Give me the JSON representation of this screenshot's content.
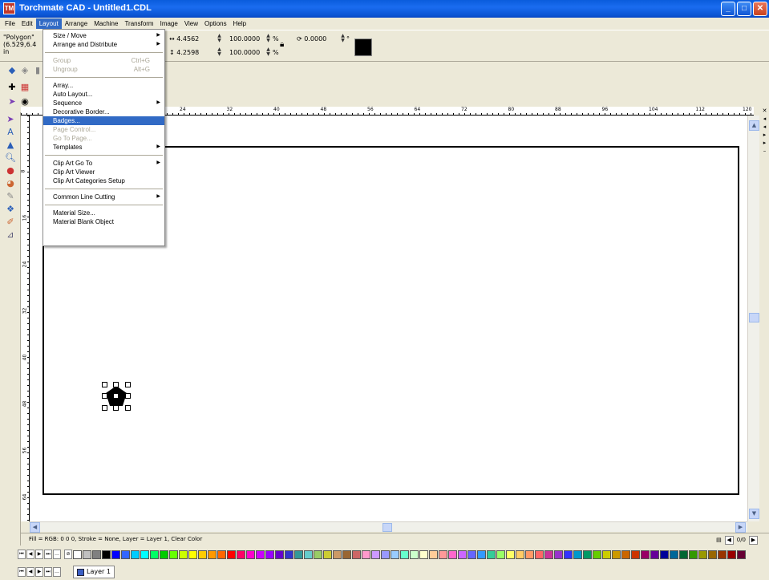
{
  "window": {
    "title": "Torchmate CAD - Untitled1.CDL",
    "app_icon_label": "TM",
    "minimize": "_",
    "maximize": "□",
    "close": "✕"
  },
  "menubar": {
    "items": [
      "File",
      "Edit",
      "Layout",
      "Arrange",
      "Machine",
      "Transform",
      "Image",
      "View",
      "Options",
      "Help"
    ],
    "active": "Layout"
  },
  "properties": {
    "object_name": "\"Polygon\"",
    "object_pos": "(6.529,6.4",
    "unit": "in",
    "width_label": "↔",
    "width": "4.4562",
    "height_label": "↕",
    "height": "4.2598",
    "scale_x": "100.0000",
    "scale_y": "100.0000",
    "percent": "%",
    "rotate_label": "⟳",
    "rotation": "0.0000",
    "degree": "°"
  },
  "layout_menu": {
    "items": [
      {
        "label": "Size / Move",
        "submenu": true
      },
      {
        "label": "Arrange and Distribute",
        "submenu": true
      },
      {
        "sep": true
      },
      {
        "label": "Group",
        "shortcut": "Ctrl+G",
        "disabled": true
      },
      {
        "label": "Ungroup",
        "shortcut": "Alt+G",
        "disabled": true
      },
      {
        "sep": true
      },
      {
        "label": "Array..."
      },
      {
        "label": "Auto Layout..."
      },
      {
        "label": "Sequence",
        "submenu": true
      },
      {
        "label": "Decorative Border..."
      },
      {
        "label": "Badges...",
        "highlight": true
      },
      {
        "label": "Page Control...",
        "disabled": true
      },
      {
        "label": "Go To Page...",
        "disabled": true
      },
      {
        "label": "Templates",
        "submenu": true
      },
      {
        "sep": true
      },
      {
        "label": "Clip Art Go To",
        "submenu": true
      },
      {
        "label": "Clip Art Viewer"
      },
      {
        "label": "Clip Art Categories Setup"
      },
      {
        "sep": true
      },
      {
        "label": "Common Line Cutting",
        "submenu": true
      },
      {
        "sep": true
      },
      {
        "label": "Material Size..."
      },
      {
        "label": "Material Blank Object"
      }
    ]
  },
  "ruler": {
    "top_labels": [
      "24",
      "32",
      "40",
      "48",
      "56",
      "64",
      "72",
      "80",
      "88",
      "96",
      "104",
      "112",
      "120"
    ],
    "left_labels": [
      "8",
      "16",
      "24",
      "32",
      "40",
      "48",
      "56",
      "64"
    ]
  },
  "status": {
    "text": "Fill = RGB: 0 0 0, Stroke = None, Layer = Layer 1, Clear Color",
    "page_counter": "0/0"
  },
  "layers": {
    "active": "Layer 1"
  },
  "palette": {
    "colors": [
      "#ffffff",
      "#c0c0c0",
      "#808080",
      "#000000",
      "#0000ff",
      "#3366ff",
      "#00ccff",
      "#00ffff",
      "#00ff66",
      "#00cc00",
      "#66ff00",
      "#ccff00",
      "#ffff00",
      "#ffcc00",
      "#ff9900",
      "#ff6600",
      "#ff0000",
      "#ff0066",
      "#ff00cc",
      "#cc00ff",
      "#9900ff",
      "#6600cc",
      "#3333cc",
      "#339999",
      "#66cccc",
      "#99cc66",
      "#cccc33",
      "#cc9966",
      "#996633",
      "#cc6666",
      "#ff99cc",
      "#cc99ff",
      "#9999ff",
      "#99ccff",
      "#66ffcc",
      "#ccffcc",
      "#ffffcc",
      "#ffcc99",
      "#ff9999",
      "#ff66cc",
      "#cc66ff",
      "#6666ff",
      "#3399ff",
      "#33cc99",
      "#99ff66",
      "#ffff66",
      "#ffcc66",
      "#ff9966",
      "#ff6666",
      "#cc3399",
      "#9933cc",
      "#3333ff",
      "#0099cc",
      "#009966",
      "#66cc00",
      "#cccc00",
      "#cc9900",
      "#cc6600",
      "#cc3300",
      "#990066",
      "#660099",
      "#000099",
      "#006699",
      "#006633",
      "#339900",
      "#999900",
      "#996600",
      "#993300",
      "#990000",
      "#660033",
      "#330066",
      "#000066",
      "#003366",
      "#003300",
      "#336600"
    ]
  }
}
